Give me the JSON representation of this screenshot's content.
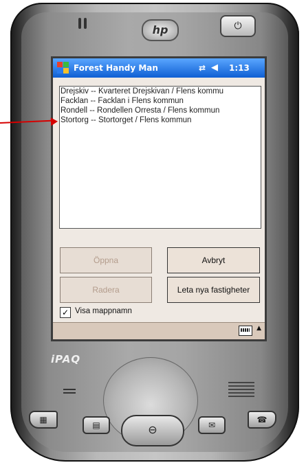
{
  "device": {
    "brand_logo": "hp",
    "model_label": "iPAQ",
    "power_symbol": "⏻",
    "hardware_buttons": [
      {
        "name": "calendar-icon",
        "glyph": "▦"
      },
      {
        "name": "contacts-icon",
        "glyph": "▤"
      },
      {
        "name": "ok-icon",
        "glyph": "⊖"
      },
      {
        "name": "mail-icon",
        "glyph": "✉"
      },
      {
        "name": "phone-icon",
        "glyph": "☎"
      }
    ]
  },
  "titlebar": {
    "app_title": "Forest Handy Man",
    "sync_icon": "⇄",
    "volume_icon": "◀",
    "time": "1:13",
    "accent_color": "#1a6ce0"
  },
  "list": {
    "items": [
      "Drejskiv -- Kvarteret Drejskivan / Flens kommu",
      "Facklan -- Facklan i Flens kommun",
      "Rondell -- Rondellen Orresta / Flens kommun",
      "Stortorg -- Stortorget / Flens kommun"
    ]
  },
  "buttons": {
    "open": "Öppna",
    "cancel": "Avbryt",
    "delete": "Radera",
    "search": "Leta nya fastigheter"
  },
  "options": {
    "show_folder_label": "Visa mappnamn",
    "show_folder_checked": true,
    "check_mark": "✓"
  },
  "menubar": {
    "input_icon": "keyboard-icon",
    "arrow": "▲"
  }
}
